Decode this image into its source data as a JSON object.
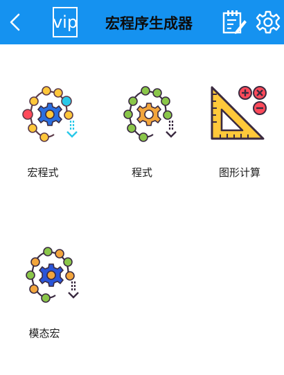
{
  "header": {
    "title": "宏程序生成器",
    "vip_label": "vip",
    "background": "#1592f0",
    "icons": [
      "back-chevron-icon",
      "edit-document-icon",
      "gear-icon"
    ]
  },
  "tiles": [
    {
      "label": "宏程式",
      "icon": "macro-gear-chain-icon"
    },
    {
      "label": "程式",
      "icon": "program-gear-chain-icon"
    },
    {
      "label": "图形计算",
      "icon": "set-square-calculator-icon"
    },
    {
      "label": "模态宏",
      "icon": "modal-macro-gear-chain-icon"
    }
  ]
}
